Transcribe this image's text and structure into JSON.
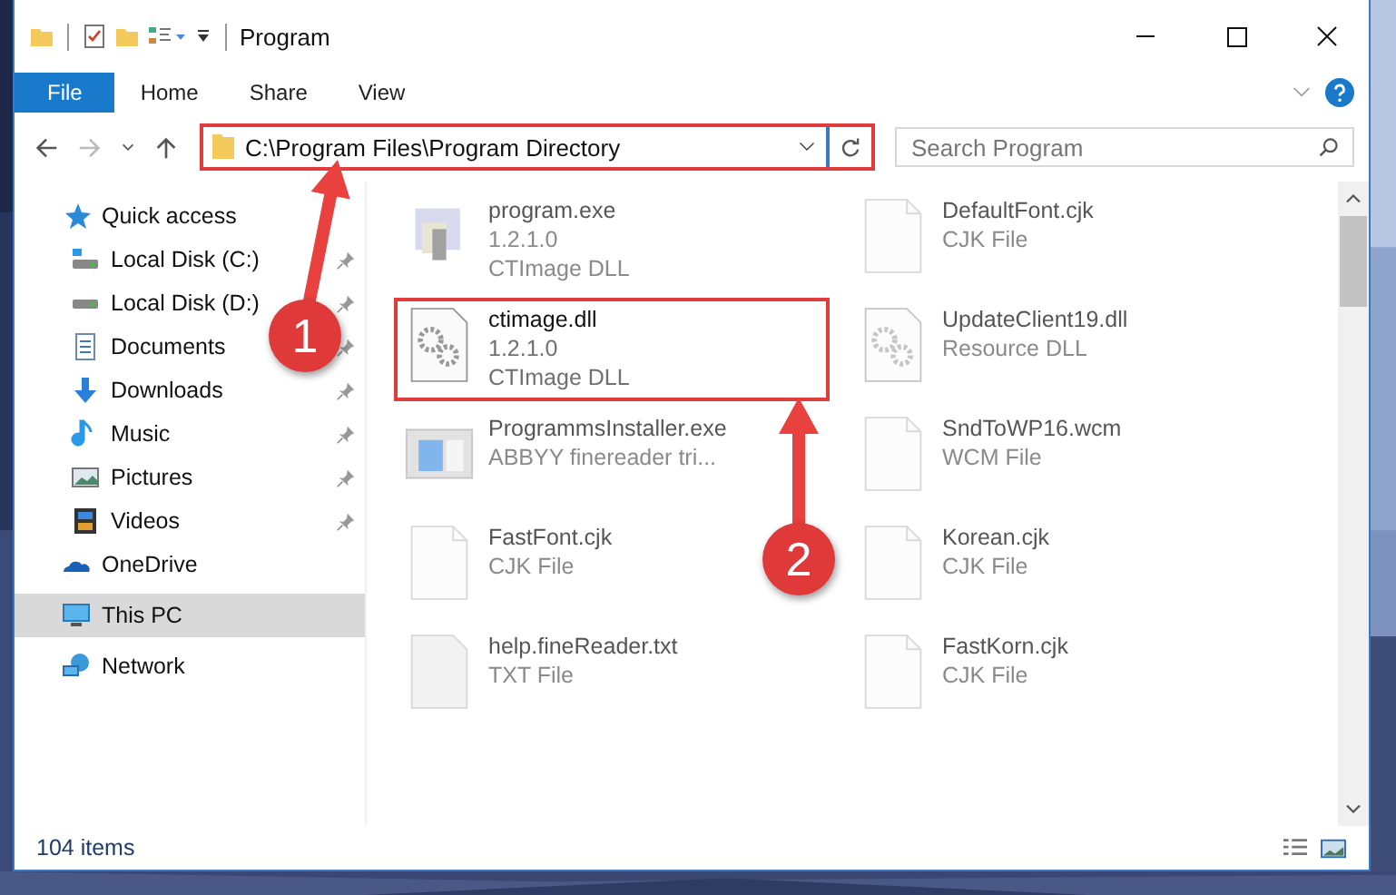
{
  "window": {
    "title": "Program"
  },
  "ribbon_tabs": [
    {
      "label": "File",
      "selected": true
    },
    {
      "label": "Home",
      "selected": false
    },
    {
      "label": "Share",
      "selected": false
    },
    {
      "label": "View",
      "selected": false
    }
  ],
  "address_bar": {
    "path": "C:\\Program Files\\Program Directory",
    "highlighted": true
  },
  "search": {
    "placeholder": "Search Program"
  },
  "sidebar": {
    "items": [
      {
        "label": "Quick access",
        "kind": "quick",
        "selected": false,
        "children": [
          {
            "label": "Local Disk (C:)",
            "kind": "system-drive",
            "pinned": true,
            "selected": false
          },
          {
            "label": "Local Disk (D:)",
            "kind": "drive",
            "pinned": true,
            "selected": false
          },
          {
            "label": "Documents",
            "kind": "documents",
            "pinned": true,
            "selected": false
          },
          {
            "label": "Downloads",
            "kind": "downloads",
            "pinned": true,
            "selected": false
          },
          {
            "label": "Music",
            "kind": "music",
            "pinned": true,
            "selected": false
          },
          {
            "label": "Pictures",
            "kind": "pictures",
            "pinned": true,
            "selected": false
          },
          {
            "label": "Videos",
            "kind": "videos",
            "pinned": true,
            "selected": false
          }
        ]
      },
      {
        "label": "OneDrive",
        "kind": "cloud",
        "selected": false
      },
      {
        "label": "This PC",
        "kind": "pc",
        "selected": true
      },
      {
        "label": "Network",
        "kind": "network",
        "selected": false
      }
    ]
  },
  "files": [
    {
      "name": "program.exe",
      "lines": [
        "1.2.1.0",
        "CTImage DLL"
      ],
      "kind": "exe",
      "blurred": true,
      "highlighted": false
    },
    {
      "name": "DefaultFont.cjk",
      "lines": [
        "CJK File"
      ],
      "kind": "blank",
      "blurred": true,
      "highlighted": false
    },
    {
      "name": "ctimage.dll",
      "lines": [
        "1.2.1.0",
        "CTImage DLL"
      ],
      "kind": "dll",
      "blurred": false,
      "highlighted": true
    },
    {
      "name": "UpdateClient19.dll",
      "lines": [
        "Resource DLL"
      ],
      "kind": "dll",
      "blurred": true,
      "highlighted": false
    },
    {
      "name": "ProgrammsInstaller.exe",
      "lines": [
        "ABBYY finereader tri..."
      ],
      "kind": "installer",
      "blurred": true,
      "highlighted": false
    },
    {
      "name": "SndToWP16.wcm",
      "lines": [
        "WCM File"
      ],
      "kind": "blank",
      "blurred": true,
      "highlighted": false
    },
    {
      "name": "FastFont.cjk",
      "lines": [
        "CJK File"
      ],
      "kind": "blank",
      "blurred": true,
      "highlighted": false
    },
    {
      "name": "Korean.cjk",
      "lines": [
        "CJK File"
      ],
      "kind": "blank",
      "blurred": true,
      "highlighted": false
    },
    {
      "name": "help.fineReader.txt",
      "lines": [
        "TXT File"
      ],
      "kind": "text",
      "blurred": true,
      "highlighted": false
    },
    {
      "name": "FastKorn.cjk",
      "lines": [
        "CJK File"
      ],
      "kind": "blank",
      "blurred": true,
      "highlighted": false
    }
  ],
  "status_bar": {
    "item_count": "104 items"
  },
  "annotations": [
    {
      "number": "1"
    },
    {
      "number": "2"
    }
  ]
}
